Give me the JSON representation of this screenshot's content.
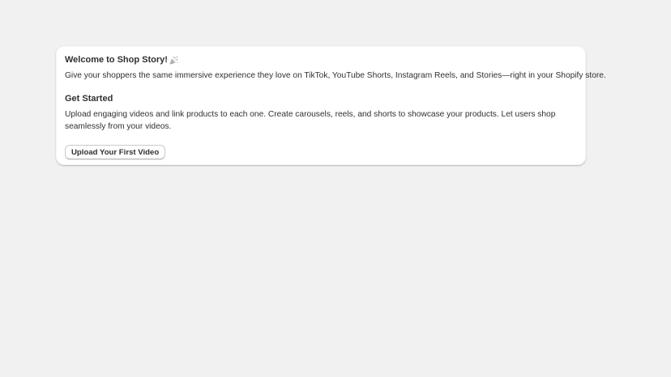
{
  "welcome_card": {
    "title": "Welcome to Shop Story!",
    "title_icon": "party-popper-icon",
    "description": "Give your shoppers the same immersive experience they love on TikTok, YouTube Shorts, Instagram Reels, and Stories—right in your Shopify store.",
    "get_started_heading": "Get Started",
    "get_started_text": "Upload engaging videos and link products to each one. Create carousels, reels, and shorts to showcase your products. Let users shop seamlessly from your videos.",
    "upload_button_label": "Upload Your First Video"
  },
  "colors": {
    "background": "#f1f1f1",
    "card": "#ffffff",
    "text": "#303030"
  }
}
